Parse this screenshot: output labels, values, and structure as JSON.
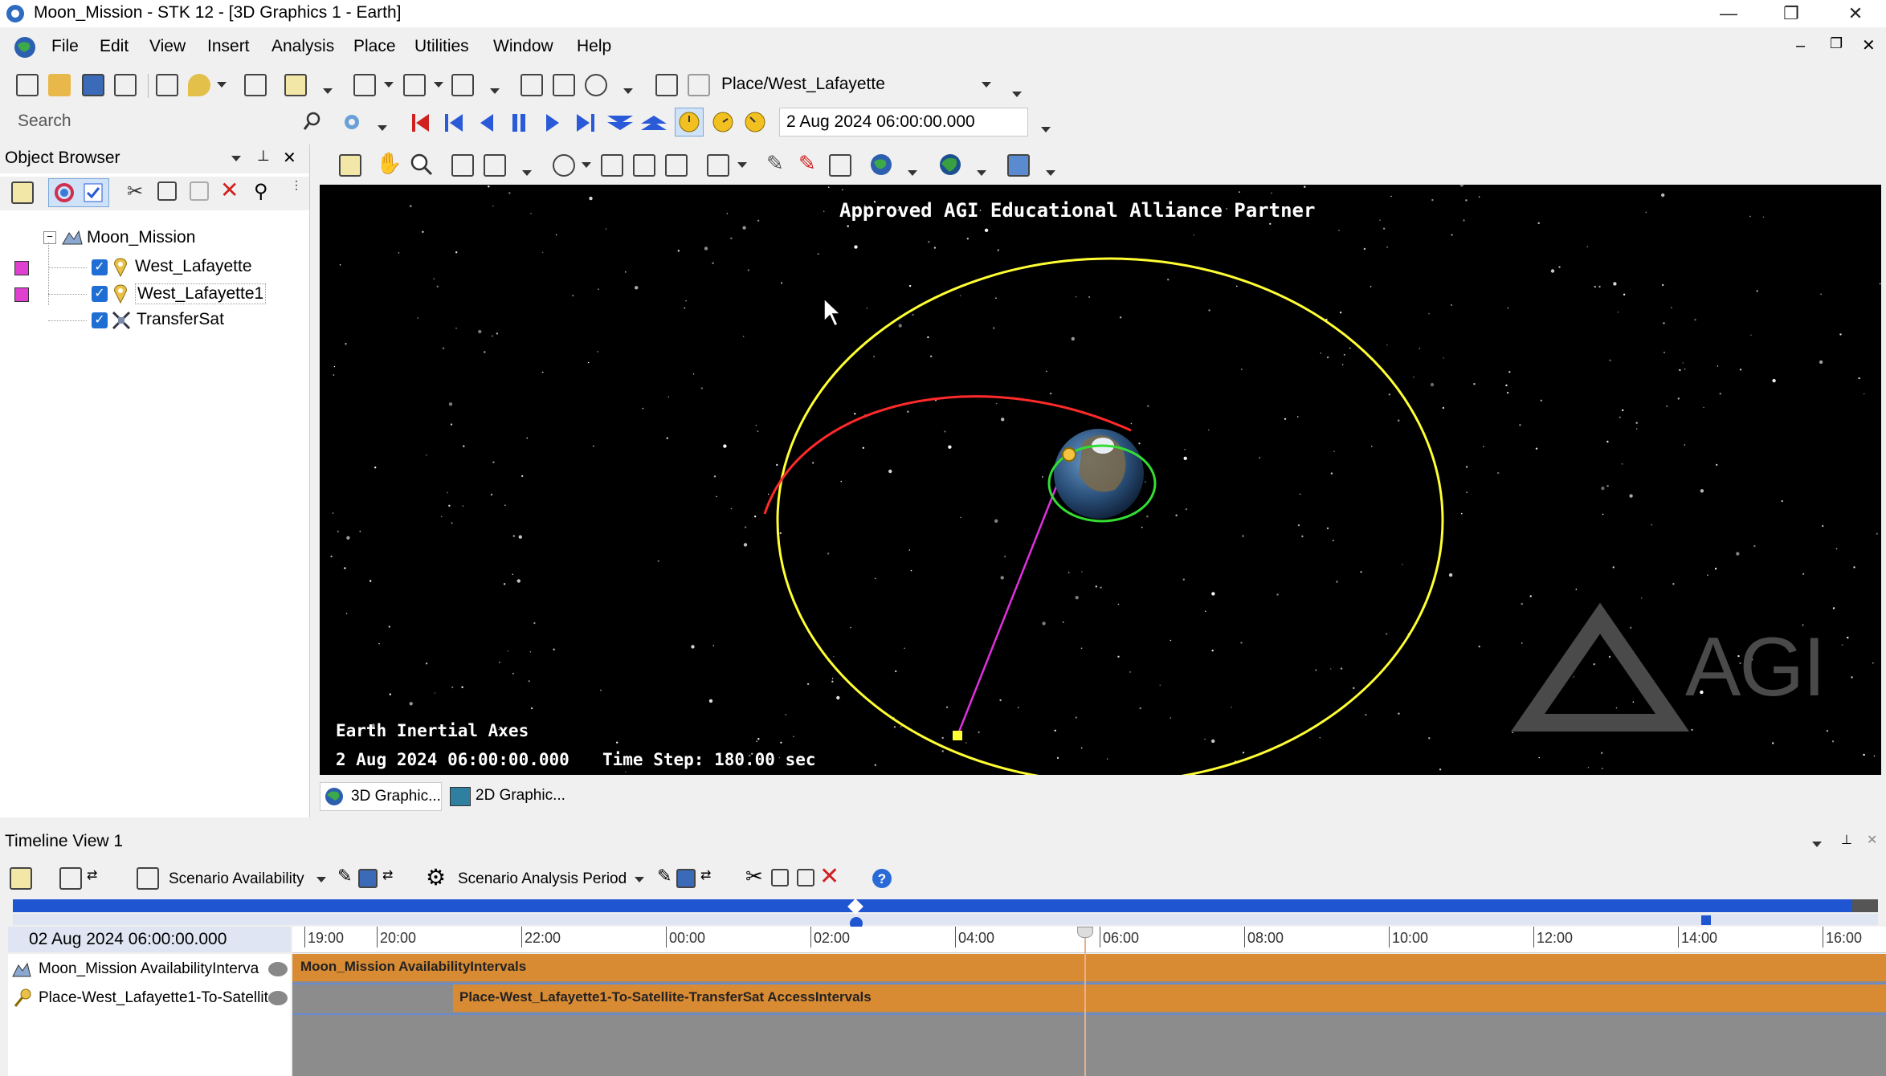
{
  "window": {
    "title": "Moon_Mission - STK 12 - [3D Graphics 1 - Earth]",
    "min_symbol": "—",
    "max_symbol": "❐",
    "close_symbol": "✕"
  },
  "menu": [
    "File",
    "Edit",
    "View",
    "Insert",
    "Analysis",
    "Place",
    "Utilities",
    "Window",
    "Help"
  ],
  "toolbar": {
    "object_select": "Place/West_Lafayette",
    "search_placeholder": "Search",
    "time_field": "2 Aug 2024 06:00:00.000"
  },
  "object_browser": {
    "title": "Object Browser",
    "root": "Moon_Mission",
    "items": [
      {
        "label": "West_Lafayette",
        "icon": "place-icon",
        "color": "#e040d0",
        "checked": true
      },
      {
        "label": "West_Lafayette1",
        "icon": "place-icon",
        "color": "#e040d0",
        "checked": true
      },
      {
        "label": "TransferSat",
        "icon": "satellite-icon",
        "checked": true
      }
    ]
  },
  "viewer": {
    "banner": "Approved AGI Educational Alliance Partner",
    "axes": "Earth Inertial Axes",
    "epoch": "2 Aug 2024 06:00:00.000",
    "time_step": "Time Step: 180.00 sec",
    "watermark": "AGI",
    "colors": {
      "orbit": "#ffff33",
      "arc": "#ff2a2a",
      "access_line": "#e030e0",
      "ground_ring": "#33dd33"
    }
  },
  "viewer_tabs": [
    "3D Graphic...",
    "2D Graphic..."
  ],
  "timeline": {
    "title": "Timeline View 1",
    "filter1": "Scenario Availability",
    "filter2": "Scenario Analysis Period",
    "current_time": "02 Aug 2024 06:00:00.000",
    "ticks": [
      "19:00",
      "20:00",
      "22:00",
      "00:00",
      "02:00",
      "04:00",
      "06:00",
      "08:00",
      "10:00",
      "12:00",
      "14:00",
      "16:00"
    ],
    "rows": [
      {
        "label": "Moon_Mission AvailabilityInterva",
        "bar": "Moon_Mission AvailabilityIntervals"
      },
      {
        "label": "Place-West_Lafayette1-To-Satellit",
        "bar": "Place-West_Lafayette1-To-Satellite-TransferSat AccessIntervals"
      }
    ]
  }
}
